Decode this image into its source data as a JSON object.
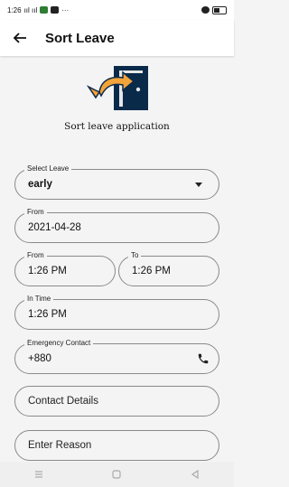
{
  "status_bar": {
    "time": "1:26",
    "signal_text": "ııl ııl",
    "extra": "···"
  },
  "app_bar": {
    "title": "Sort Leave"
  },
  "hero": {
    "caption": "Sort leave application"
  },
  "form": {
    "select_leave": {
      "label": "Select Leave",
      "value": "early"
    },
    "from_date": {
      "label": "From",
      "value": "2021-04-28"
    },
    "from_time": {
      "label": "From",
      "value": "1:26 PM"
    },
    "to_time": {
      "label": "To",
      "value": "1:26 PM"
    },
    "in_time": {
      "label": "In Time",
      "value": "1:26 PM"
    },
    "emergency_contact": {
      "label": "Emergency Contact",
      "value": "+880"
    },
    "contact_details": {
      "placeholder": "Contact Details"
    },
    "reason": {
      "placeholder": "Enter Reason"
    }
  },
  "colors": {
    "door": "#0a2a4a",
    "arrow": "#f2a33a"
  }
}
